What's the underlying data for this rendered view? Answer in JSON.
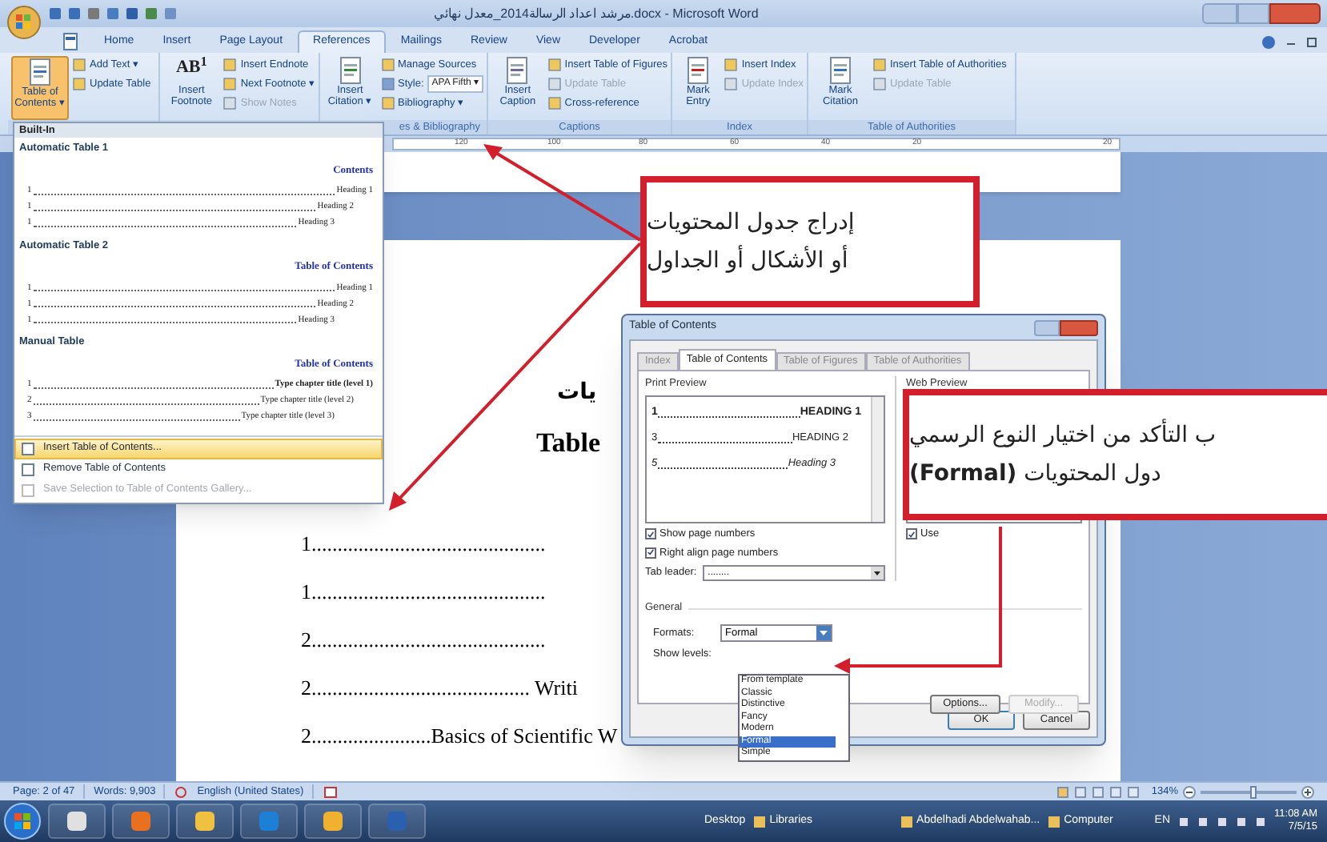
{
  "window": {
    "title": "مرشد اعداد الرسالة2014_معدل نهائي.docx - Microsoft Word"
  },
  "ribbon_tabs": [
    {
      "label": "Home",
      "selected": false
    },
    {
      "label": "Insert",
      "selected": false
    },
    {
      "label": "Page Layout",
      "selected": false
    },
    {
      "label": "References",
      "selected": true
    },
    {
      "label": "Mailings",
      "selected": false
    },
    {
      "label": "Review",
      "selected": false
    },
    {
      "label": "View",
      "selected": false
    },
    {
      "label": "Developer",
      "selected": false
    },
    {
      "label": "Acrobat",
      "selected": false
    }
  ],
  "ribbon_groups": [
    {
      "large": {
        "label": "Table of\nContents ▾",
        "selected": true
      },
      "small": [
        {
          "kind": "button",
          "label": "Add Text ▾",
          "disabled": false
        },
        {
          "kind": "button",
          "label": "Update Table",
          "disabled": false
        }
      ]
    },
    {
      "large": {
        "label": "Insert\nFootnote",
        "icon_text": "AB$^{1}$",
        "selected": false
      },
      "small": [
        {
          "kind": "button",
          "label": "Insert Endnote",
          "disabled": false
        },
        {
          "kind": "button",
          "label": "Next Footnote ▾",
          "disabled": false
        },
        {
          "kind": "button",
          "label": "Show Notes",
          "disabled": true
        }
      ]
    },
    {
      "label": "es & Bibliography",
      "large": {
        "label": "Insert\nCitation ▾",
        "selected": false
      },
      "small": [
        {
          "kind": "button",
          "label": "Manage Sources",
          "disabled": false
        },
        {
          "kind": "combo",
          "label": "Style:",
          "value": "APA Fifth ▾",
          "disabled": false
        },
        {
          "kind": "button",
          "label": "Bibliography ▾",
          "disabled": false
        }
      ]
    },
    {
      "label": "Captions",
      "large": {
        "label": "Insert\nCaption",
        "selected": false
      },
      "small": [
        {
          "kind": "button",
          "label": "Insert Table of Figures",
          "disabled": false
        },
        {
          "kind": "button",
          "label": "Update Table",
          "disabled": true
        },
        {
          "kind": "button",
          "label": "Cross-reference",
          "disabled": false
        }
      ]
    },
    {
      "label": "Index",
      "large": {
        "label": "Mark\nEntry",
        "selected": false
      },
      "small": [
        {
          "kind": "button",
          "label": "Insert Index",
          "disabled": false
        },
        {
          "kind": "button",
          "label": "Update Index",
          "disabled": true
        }
      ]
    },
    {
      "label": "Table of Authorities",
      "large": {
        "label": "Mark\nCitation",
        "selected": false
      },
      "small": [
        {
          "kind": "button",
          "label": "Insert Table of Authorities",
          "disabled": false
        },
        {
          "kind": "button",
          "label": "Update Table",
          "disabled": true
        }
      ]
    }
  ],
  "ruler_labels": [
    "120",
    "100",
    "80",
    "60",
    "40",
    "20",
    "20"
  ],
  "toc_menu": {
    "header": "Built-In",
    "sections": [
      {
        "title": "Automatic Table 1",
        "heading": "Contents",
        "entries": [
          {
            "number": "1",
            "text": "Heading 1"
          },
          {
            "number": "1",
            "text": "Heading 2"
          },
          {
            "number": "1",
            "text": "Heading 3"
          }
        ]
      },
      {
        "title": "Automatic Table 2",
        "heading": "Table of Contents",
        "entries": [
          {
            "number": "1",
            "text": "Heading 1"
          },
          {
            "number": "1",
            "text": "Heading 2"
          },
          {
            "number": "1",
            "text": "Heading 3"
          }
        ]
      },
      {
        "title": "Manual Table",
        "heading": "Table of Contents",
        "entries": [
          {
            "number": "1",
            "text": "Type chapter title (level 1)"
          },
          {
            "number": "2",
            "text": "Type chapter title (level 2)"
          },
          {
            "number": "3",
            "text": "Type chapter title (level 3)"
          }
        ]
      }
    ],
    "items": [
      {
        "label": "Insert Table of Contents...",
        "selected": true,
        "disabled": false
      },
      {
        "label": "Remove Table of Contents",
        "selected": false,
        "disabled": false
      },
      {
        "label": "Save Selection to Table of Contents Gallery...",
        "selected": false,
        "disabled": true
      }
    ]
  },
  "document": {
    "heading_ar": "يات",
    "heading": "Table",
    "lines": [
      "1.............................................",
      "1.............................................",
      "2.............................................",
      "2.......................................... Writi",
      "2.......................Basics of Scientific W"
    ]
  },
  "dialog": {
    "title": "Table of Contents",
    "tabs": [
      {
        "label": "Index",
        "selected": false
      },
      {
        "label": "Table of Contents",
        "selected": true
      },
      {
        "label": "Table of Figures",
        "selected": false
      },
      {
        "label": "Table of Authorities",
        "selected": false
      }
    ],
    "print_preview": {
      "label": "Print Preview",
      "lines": [
        {
          "number": "1",
          "text": "HEADING 1"
        },
        {
          "number": "3",
          "text": "HEADING 2"
        },
        {
          "number": "5",
          "text": "Heading 3"
        }
      ]
    },
    "checkboxes": [
      {
        "label": "Show page numbers",
        "checked": true
      },
      {
        "label": "Right align page numbers",
        "checked": true
      }
    ],
    "tab_leader": {
      "label": "Tab leader:",
      "value": "........"
    },
    "web_preview": {
      "label": "Web Preview",
      "checkbox": {
        "label": "Use",
        "checked": true
      }
    },
    "general": {
      "label": "General",
      "formats": {
        "label": "Formats:",
        "value": "Formal",
        "options": [
          {
            "label": "From template",
            "selected": false
          },
          {
            "label": "Classic",
            "selected": false
          },
          {
            "label": "Distinctive",
            "selected": false
          },
          {
            "label": "Fancy",
            "selected": false
          },
          {
            "label": "Modern",
            "selected": false
          },
          {
            "label": "Formal",
            "selected": true
          },
          {
            "label": "Simple",
            "selected": false
          }
        ]
      },
      "show_levels": {
        "label": "Show levels:"
      }
    },
    "buttons": [
      {
        "label": "Options...",
        "disabled": false
      },
      {
        "label": "Modify...",
        "disabled": true
      }
    ],
    "footer_buttons": [
      "OK",
      "Cancel"
    ]
  },
  "callouts": [
    {
      "lines": [
        "إدراج جدول المحتويات",
        "أو الأشكال أو الجداول"
      ]
    },
    {
      "lines": [
        "ب التأكد من اختيار النوع الرسمي",
        "دول المحتويات **(Formal)**"
      ]
    }
  ],
  "status_bar": {
    "items": [
      "Page: 2 of 47",
      "Words: 9,903",
      "English (United States)"
    ],
    "zoom": "134%",
    "zoom_slider": {
      "level": 0.55
    }
  },
  "taskbar": {
    "desktop": "Desktop",
    "windows": [
      "Libraries",
      "Abdelhadi Abdelwahab...",
      "Computer"
    ],
    "language": "EN",
    "time": "11:08 AM",
    "date": "7/5/15"
  }
}
